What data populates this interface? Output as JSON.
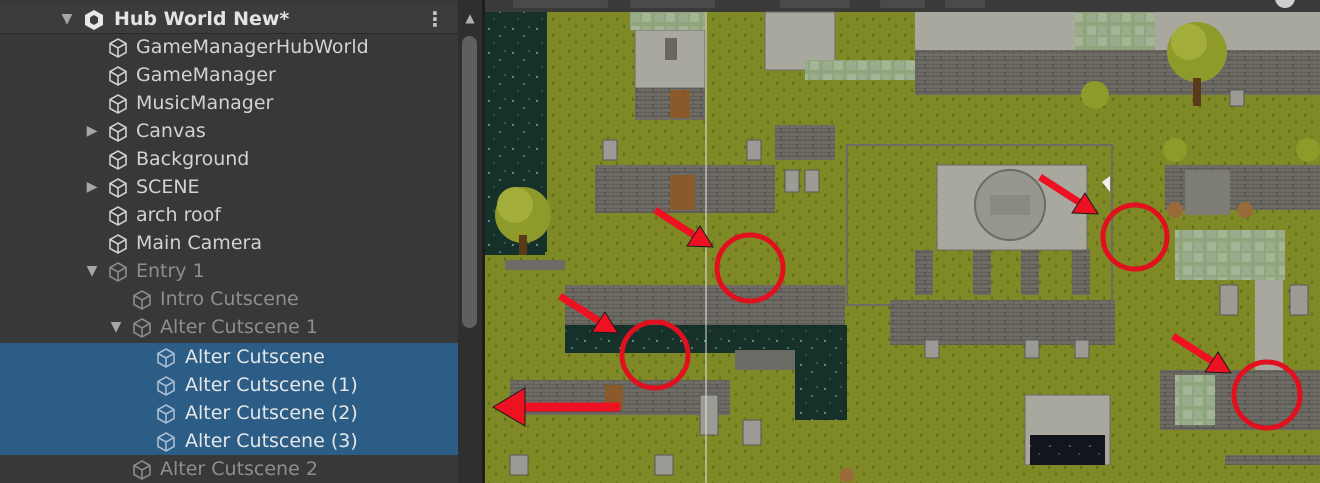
{
  "hierarchy": {
    "scene_title": "Hub World New*",
    "items": [
      {
        "label": "GameManagerHubWorld"
      },
      {
        "label": "GameManager"
      },
      {
        "label": "MusicManager"
      },
      {
        "label": "Canvas"
      },
      {
        "label": "Background"
      },
      {
        "label": "SCENE"
      },
      {
        "label": "arch roof"
      },
      {
        "label": "Main Camera"
      },
      {
        "label": "Entry 1"
      },
      {
        "label": "Intro Cutscene"
      },
      {
        "label": "Alter Cutscene 1"
      },
      {
        "label": "Alter Cutscene"
      },
      {
        "label": "Alter Cutscene (1)"
      },
      {
        "label": "Alter Cutscene (2)"
      },
      {
        "label": "Alter Cutscene (3)"
      },
      {
        "label": "Alter Cutscene 2"
      }
    ],
    "selected_items": [
      "Alter Cutscene",
      "Alter Cutscene (1)",
      "Alter Cutscene (2)",
      "Alter Cutscene (3)"
    ],
    "disabled_items": [
      "Entry 1",
      "Intro Cutscene",
      "Alter Cutscene 1",
      "Alter Cutscene",
      "Alter Cutscene (1)",
      "Alter Cutscene (2)",
      "Alter Cutscene (3)",
      "Alter Cutscene 2"
    ]
  },
  "scene_view": {
    "annotations": {
      "circle_color": "#e0101e",
      "arrow_color": "#ee1122",
      "marked_spots": 4
    }
  },
  "colors": {
    "panel_bg": "#383838",
    "selection": "#2c5d87",
    "grass": "#7f8a26",
    "stone": "#9b9a94"
  }
}
